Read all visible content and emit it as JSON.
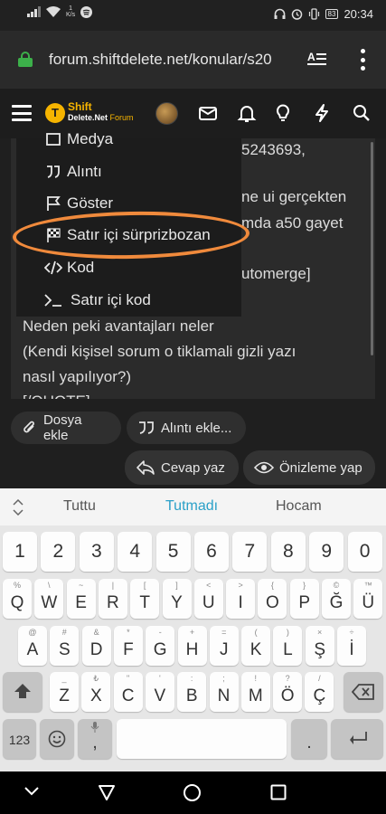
{
  "status_bar": {
    "speed_value": "1",
    "speed_unit": "K/s",
    "battery": "83",
    "time": "20:34"
  },
  "browser": {
    "url": "forum.shiftdelete.net/konular/s20"
  },
  "forum_nav": {
    "logo_line1": "Shift",
    "logo_line2_a": "Delete",
    "logo_line2_b": ".Net",
    "logo_line2_c": " Forum"
  },
  "editor": {
    "lines": [
      {
        "text": "5243693,",
        "indent": "right"
      },
      {
        "text": "ne ui gerçekten",
        "indent": "right"
      },
      {
        "text": "mda a50 gayet",
        "indent": "right"
      },
      {
        "text": "utomerge]",
        "indent": "right"
      },
      {
        "text": "Neden peki avantajları neler",
        "indent": "full"
      },
      {
        "text": "(Kendi kişisel sorum o tiklamali gizli yazı",
        "indent": "full"
      },
      {
        "text": "nasıl yapılıyor?)",
        "indent": "full"
      },
      {
        "text": "[/QUOTE]",
        "indent": "full"
      }
    ]
  },
  "insert_menu": {
    "items": [
      {
        "label": "Medya",
        "icon": "media-icon"
      },
      {
        "label": "Alıntı",
        "icon": "quote-icon"
      },
      {
        "label": "Göster",
        "icon": "flag-icon"
      },
      {
        "label": "Satır içi sürprizbozan",
        "icon": "checkered-flag-icon",
        "highlighted": true
      },
      {
        "label": "Kod",
        "icon": "code-icon"
      },
      {
        "label": "Satır içi kod",
        "icon": "terminal-icon"
      }
    ]
  },
  "actions": {
    "attach_label": "Dosya ekle",
    "insert_quote_label": "Alıntı ekle...",
    "reply_label": "Cevap yaz",
    "preview_label": "Önizleme yap"
  },
  "keyboard": {
    "suggestions": [
      "Tuttu",
      "Tutmadı",
      "Hocam"
    ],
    "active_suggestion_color": "#2aa0c8",
    "row_numbers": [
      "1",
      "2",
      "3",
      "4",
      "5",
      "6",
      "7",
      "8",
      "9",
      "0"
    ],
    "row1": [
      [
        "Q",
        "%"
      ],
      [
        "W",
        "\\"
      ],
      [
        "E",
        "~"
      ],
      [
        "R",
        "|"
      ],
      [
        "T",
        "["
      ],
      [
        "Y",
        "]"
      ],
      [
        "U",
        "<"
      ],
      [
        "I",
        ">"
      ],
      [
        "O",
        "{"
      ],
      [
        "P",
        "}"
      ],
      [
        "Ğ",
        "©"
      ],
      [
        "Ü",
        "™"
      ]
    ],
    "row2": [
      [
        "A",
        "@"
      ],
      [
        "S",
        "#"
      ],
      [
        "D",
        "&"
      ],
      [
        "F",
        "*"
      ],
      [
        "G",
        "-"
      ],
      [
        "H",
        "+"
      ],
      [
        "J",
        "="
      ],
      [
        "K",
        "("
      ],
      [
        "L",
        ")"
      ],
      [
        "Ş",
        "×"
      ],
      [
        "İ",
        "÷"
      ]
    ],
    "row3": [
      [
        "Z",
        "_"
      ],
      [
        "X",
        "₺"
      ],
      [
        "C",
        "\""
      ],
      [
        "V",
        "'"
      ],
      [
        "B",
        ":"
      ],
      [
        "N",
        ";"
      ],
      [
        "M",
        "!"
      ],
      [
        "Ö",
        "?"
      ],
      [
        "Ç",
        "/"
      ]
    ],
    "mode_label": "123",
    "comma": ",",
    "period": "."
  }
}
